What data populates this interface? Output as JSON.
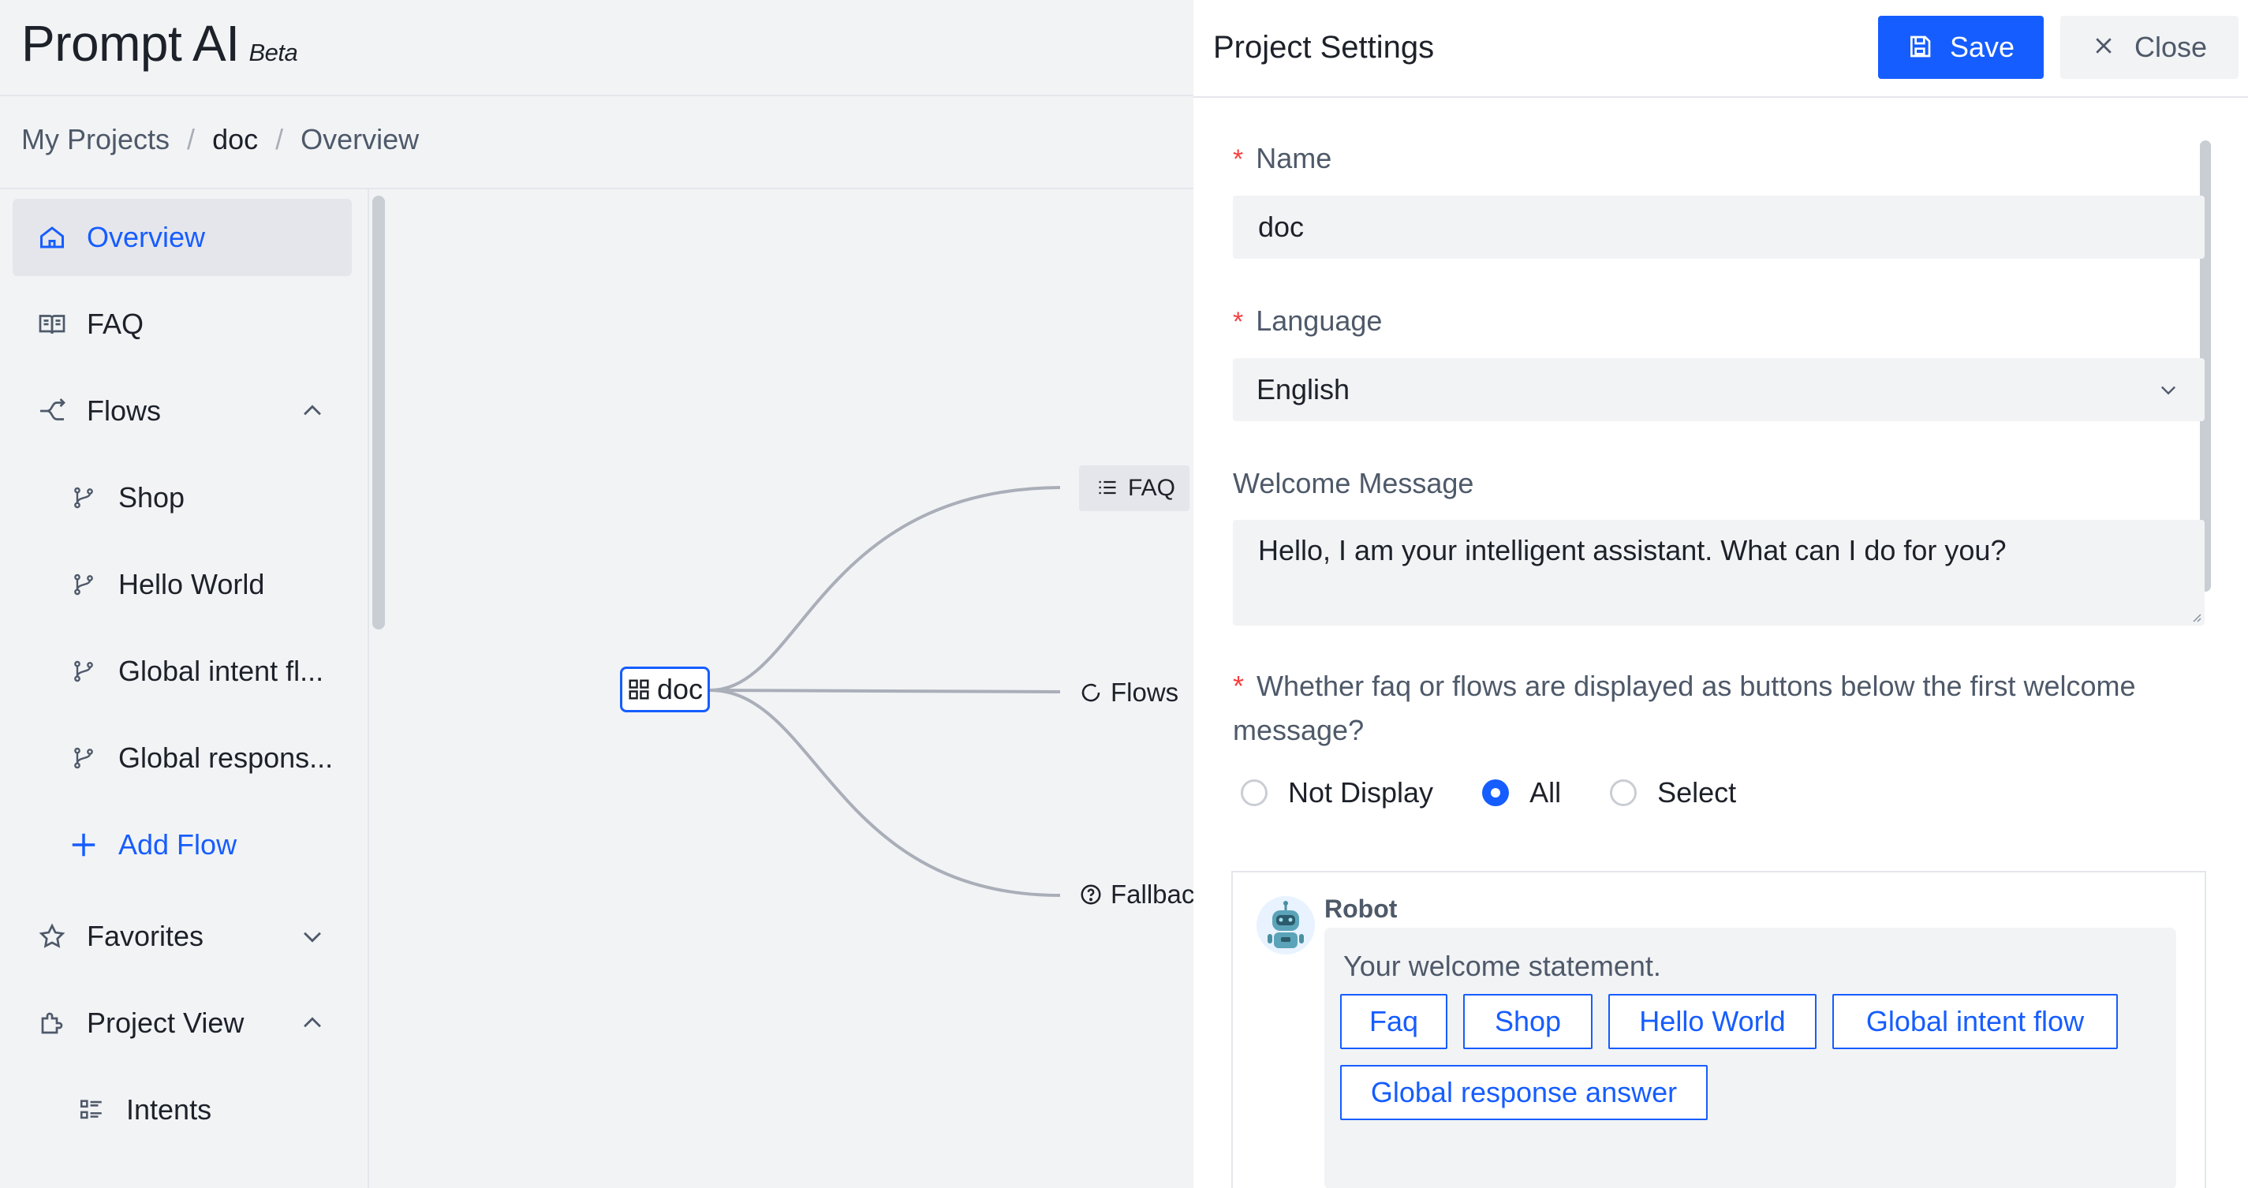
{
  "app": {
    "logo": "Prompt AI",
    "logo_badge": "Beta"
  },
  "breadcrumb": {
    "items": [
      "My Projects",
      "doc",
      "Overview"
    ],
    "separator": "/"
  },
  "sidebar": {
    "items": [
      {
        "label": "Overview",
        "icon": "home-icon",
        "active": true
      },
      {
        "label": "FAQ",
        "icon": "book-icon"
      },
      {
        "label": "Flows",
        "icon": "flow-icon",
        "expanded": true
      },
      {
        "label": "Shop",
        "icon": "branch-icon"
      },
      {
        "label": "Hello World",
        "icon": "branch-icon"
      },
      {
        "label": "Global intent fl...",
        "icon": "branch-icon"
      },
      {
        "label": "Global respons...",
        "icon": "branch-icon"
      },
      {
        "label": "Add Flow",
        "icon": "plus-icon"
      },
      {
        "label": "Favorites",
        "icon": "star-icon",
        "expanded": false
      },
      {
        "label": "Project View",
        "icon": "puzzle-icon",
        "expanded": true
      },
      {
        "label": "Intents",
        "icon": "list-icon"
      }
    ]
  },
  "mindmap": {
    "root": "doc",
    "children": [
      "FAQ",
      "Flows",
      "Fallback"
    ]
  },
  "drawer": {
    "title": "Project Settings",
    "save_label": "Save",
    "close_label": "Close",
    "name_label": "Name",
    "name_value": "doc",
    "language_label": "Language",
    "language_value": "English",
    "welcome_label": "Welcome Message",
    "welcome_value": "Hello, I am your intelligent assistant. What can I do for you?",
    "display_question": "Whether faq or flows are displayed as buttons below the first welcome message?",
    "display_options": [
      "Not Display",
      "All",
      "Select"
    ],
    "display_selected": "All",
    "required_mark": "*"
  },
  "preview": {
    "sender": "Robot",
    "message": "Your welcome statement.",
    "buttons": [
      "Faq",
      "Shop",
      "Hello World",
      "Global intent flow",
      "Global response answer"
    ]
  },
  "colors": {
    "primary": "#165dff",
    "danger": "#f53f3f",
    "background": "#f2f3f5"
  }
}
